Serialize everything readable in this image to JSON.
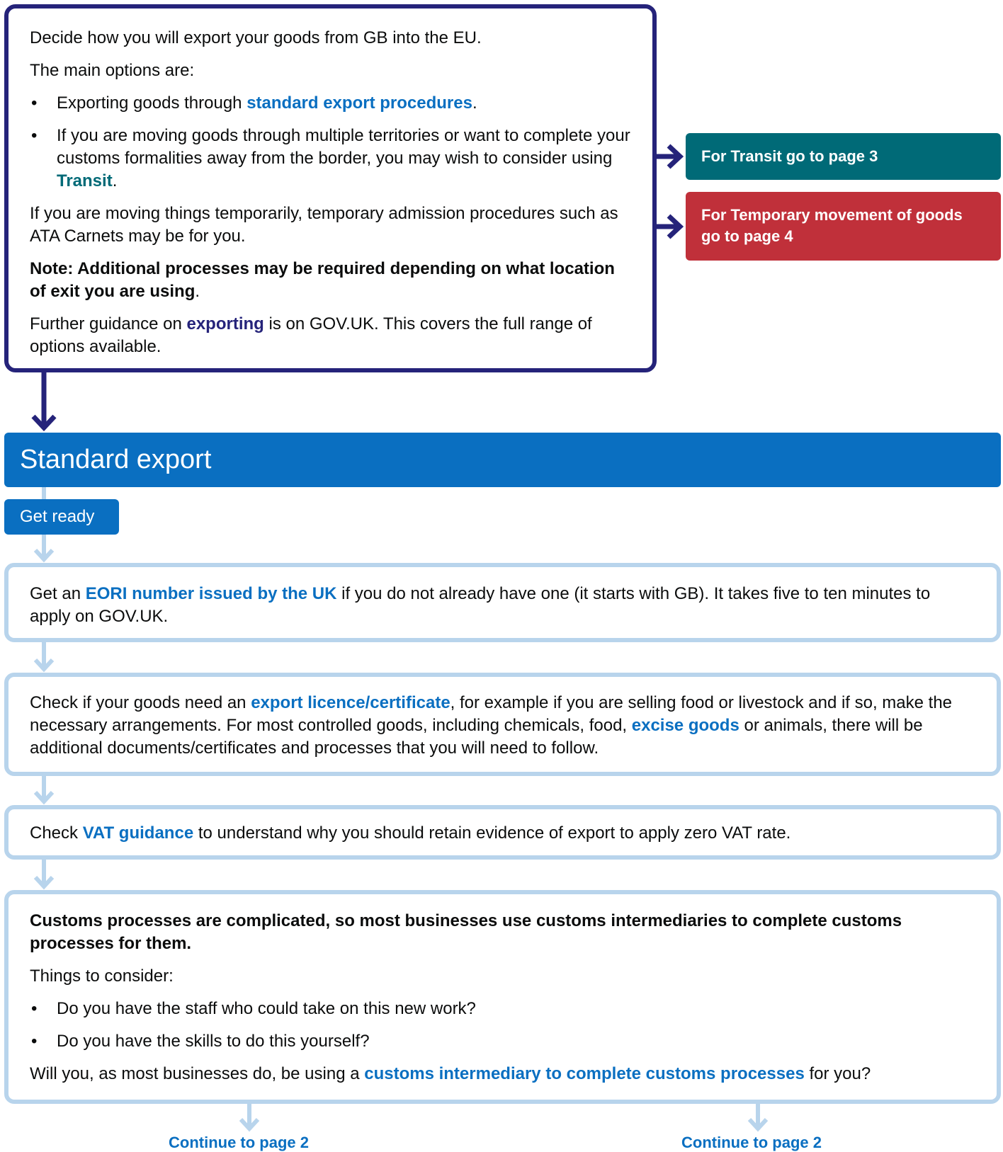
{
  "intro": {
    "p1": "Decide how you will export your goods from GB into the EU.",
    "p2": "The main options are:",
    "b1_pre": "Exporting goods through ",
    "b1_link": "standard export procedures",
    "b1_post": ".",
    "b2_pre": "If you are moving goods through multiple territories or want to complete your customs formalities away from the border, you may wish to consider using ",
    "b2_link": "Transit",
    "b2_post": ".",
    "p3": "If you are moving things temporarily, temporary admission procedures such as ATA Carnets may be for you.",
    "note_bold": "Note: Additional processes may be required depending on what location of exit you are using",
    "note_post": ".",
    "p4_pre": "Further guidance on ",
    "p4_link": "exporting",
    "p4_post": " is on GOV.UK.  This covers the full range of options available."
  },
  "side": {
    "transit": "For Transit go to page 3",
    "temporary": "For Temporary movement of goods go to page 4"
  },
  "section": {
    "title": "Standard export",
    "get_ready": "Get ready"
  },
  "steps": {
    "s1_pre": "Get an ",
    "s1_link": "EORI number issued by the UK",
    "s1_post": " if you do not already have one (it starts with GB). It takes five to ten minutes to apply on GOV.UK.",
    "s2_pre": "Check if your goods need an ",
    "s2_link1": "export licence/certificate",
    "s2_mid": ", for example if you are selling food or livestock and if so, make the necessary arrangements. For most controlled goods, including chemicals, food, ",
    "s2_link2": "excise goods",
    "s2_post": " or animals, there will be additional documents/certificates and processes that you will need to follow.",
    "s3_pre": "Check ",
    "s3_link": "VAT guidance",
    "s3_post": " to understand why you should retain evidence of export to apply zero VAT rate.",
    "s4_bold": "Customs processes are complicated, so most businesses use customs intermediaries to complete customs processes for them.",
    "s4_consider": "Things to consider:",
    "s4_b1": "Do you have the staff who could take on this new work?",
    "s4_b2": "Do you have the skills to do this yourself?",
    "s4_q_pre": "Will you, as most businesses do, be using a ",
    "s4_q_link": "customs intermediary to complete customs processes",
    "s4_q_post": " for you?"
  },
  "continue": {
    "left": "Continue to page 2",
    "right": "Continue to page 2"
  },
  "colors": {
    "navy": "#25237a",
    "blue": "#0a6fc1",
    "teal": "#006a77",
    "red": "#c0303a",
    "light_blue": "#b8d4ec"
  }
}
